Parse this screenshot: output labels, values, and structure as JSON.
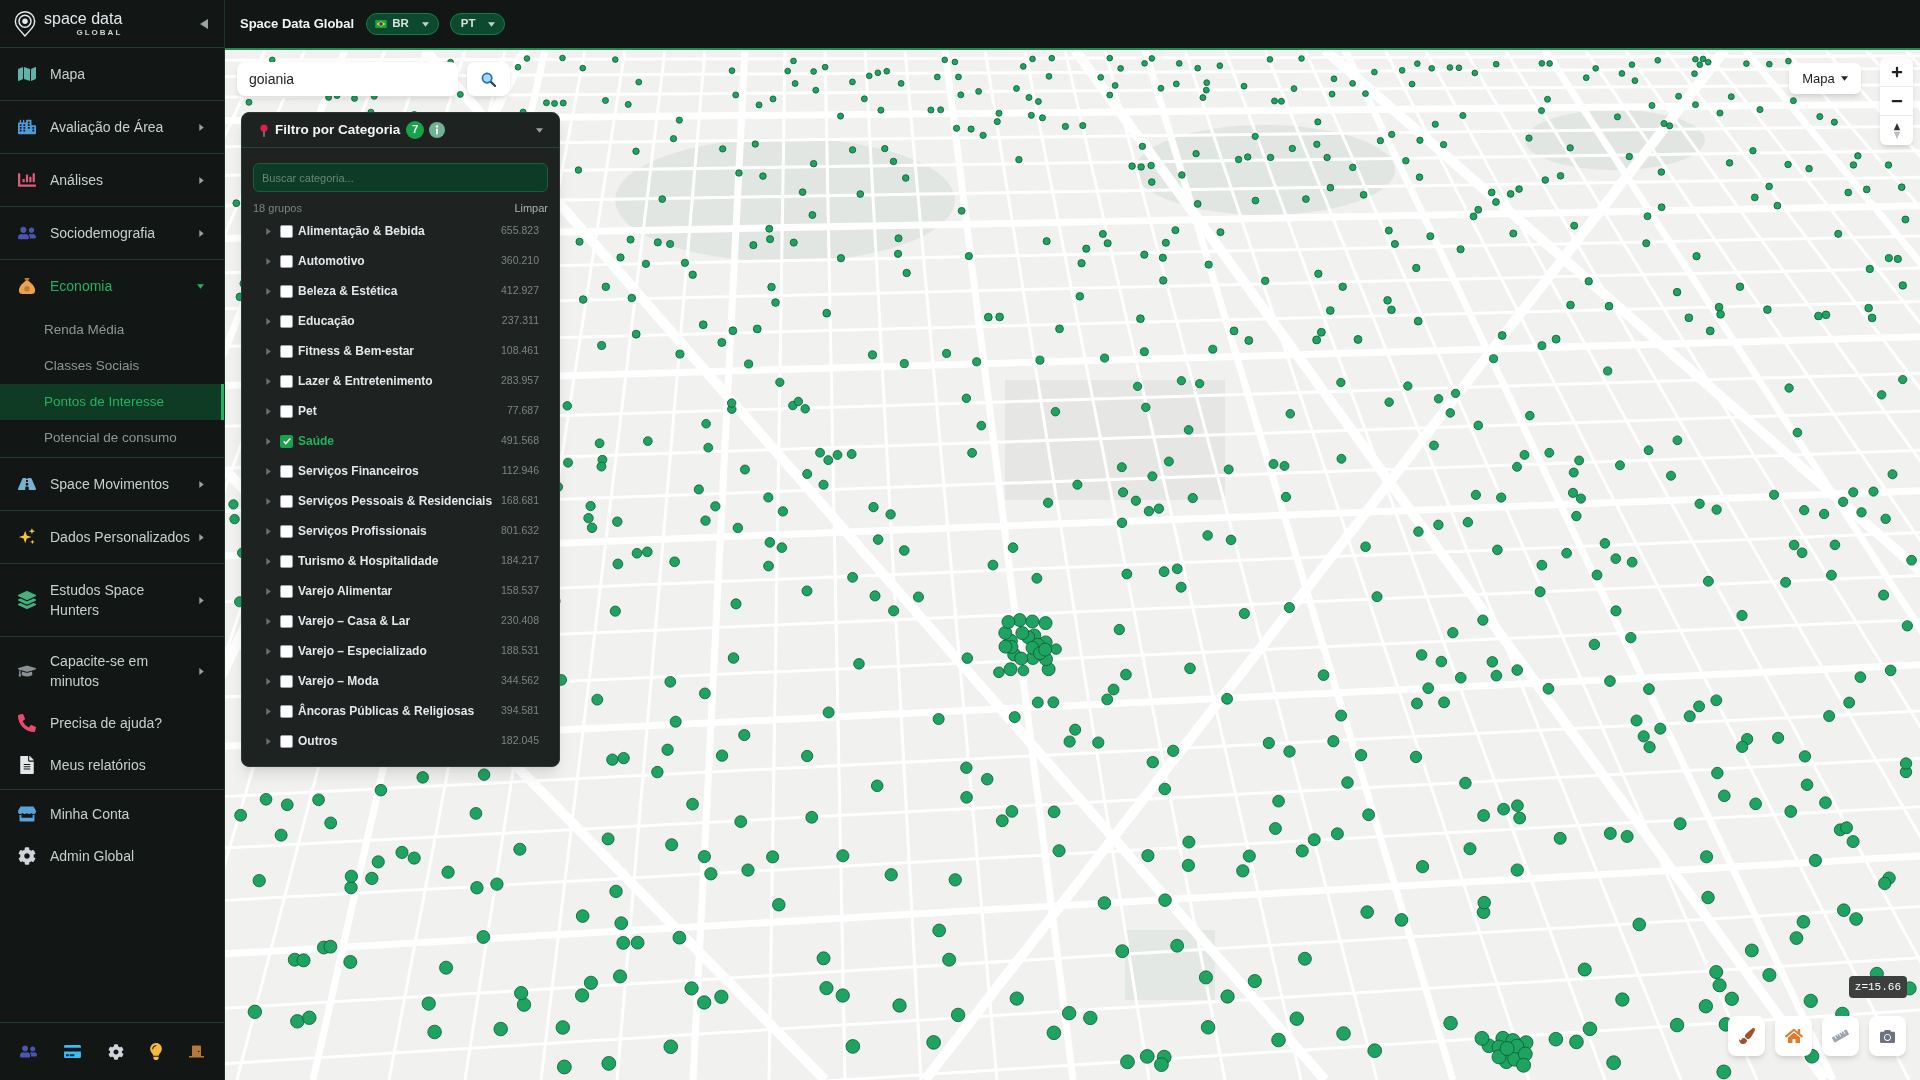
{
  "sidebar": {
    "brand": {
      "name": "space data",
      "tagline": "GLOBAL"
    },
    "sections": [
      {
        "items": [
          {
            "label": "Mapa",
            "kind": "link"
          }
        ]
      },
      {
        "items": [
          {
            "label": "Avaliação de Área",
            "kind": "menu",
            "expanded": false
          }
        ]
      },
      {
        "items": [
          {
            "label": "Análises",
            "kind": "menu",
            "expanded": false
          }
        ]
      },
      {
        "items": [
          {
            "label": "Sociodemografia",
            "kind": "menu",
            "expanded": false
          }
        ]
      },
      {
        "items": [
          {
            "label": "Economia",
            "kind": "menu",
            "expanded": true,
            "children": [
              {
                "label": "Renda Média",
                "selected": false
              },
              {
                "label": "Classes Sociais",
                "selected": false
              },
              {
                "label": "Pontos de Interesse",
                "selected": true
              },
              {
                "label": "Potencial de consumo",
                "selected": false
              }
            ]
          }
        ]
      },
      {
        "items": [
          {
            "label": "Space Movimentos",
            "kind": "menu",
            "expanded": false
          }
        ]
      },
      {
        "items": [
          {
            "label": "Dados Personalizados",
            "kind": "menu",
            "expanded": false
          }
        ]
      },
      {
        "items": [
          {
            "label": "Estudos Space Hunters",
            "kind": "menu",
            "expanded": false
          }
        ]
      },
      {
        "items": [
          {
            "label": "Capacite-se em minutos",
            "kind": "menu",
            "expanded": false
          },
          {
            "label": "Precisa de ajuda?",
            "kind": "link"
          },
          {
            "label": "Meus relatórios",
            "kind": "link"
          }
        ]
      },
      {
        "items": [
          {
            "label": "Minha Conta",
            "kind": "link"
          },
          {
            "label": "Admin Global",
            "kind": "link"
          }
        ]
      }
    ]
  },
  "topbar": {
    "title": "Space Data Global",
    "country": {
      "label": "BR"
    },
    "language": {
      "label": "PT"
    }
  },
  "map": {
    "search": {
      "value": "goiania"
    },
    "map_type": {
      "label": "Mapa"
    },
    "zoom_readout": "z=15.66"
  },
  "filter": {
    "title": "Filtro por Categoria",
    "badge": "7",
    "expanded": true,
    "search": {
      "placeholder": "Buscar categoria..."
    },
    "group_count": "18 grupos",
    "clear": "Limpar",
    "categories": [
      {
        "label": "Alimentação & Bebida",
        "count": "655.823",
        "checked": false
      },
      {
        "label": "Automotivo",
        "count": "360.210",
        "checked": false
      },
      {
        "label": "Beleza & Estética",
        "count": "412.927",
        "checked": false
      },
      {
        "label": "Educação",
        "count": "237.311",
        "checked": false
      },
      {
        "label": "Fitness & Bem-estar",
        "count": "108.461",
        "checked": false
      },
      {
        "label": "Lazer & Entretenimento",
        "count": "283.957",
        "checked": false
      },
      {
        "label": "Pet",
        "count": "77.687",
        "checked": false
      },
      {
        "label": "Saúde",
        "count": "491.568",
        "checked": true
      },
      {
        "label": "Serviços Financeiros",
        "count": "112.946",
        "checked": false
      },
      {
        "label": "Serviços Pessoais & Residenciais",
        "count": "168.681",
        "checked": false
      },
      {
        "label": "Serviços Profissionais",
        "count": "801.632",
        "checked": false
      },
      {
        "label": "Turismo & Hospitalidade",
        "count": "184.217",
        "checked": false
      },
      {
        "label": "Varejo Alimentar",
        "count": "158.537",
        "checked": false
      },
      {
        "label": "Varejo – Casa & Lar",
        "count": "230.408",
        "checked": false
      },
      {
        "label": "Varejo – Especializado",
        "count": "188.531",
        "checked": false
      },
      {
        "label": "Varejo – Moda",
        "count": "344.562",
        "checked": false
      },
      {
        "label": "Âncoras Públicas & Religiosas",
        "count": "394.581",
        "checked": false
      },
      {
        "label": "Outros",
        "count": "182.045",
        "checked": false
      }
    ]
  }
}
